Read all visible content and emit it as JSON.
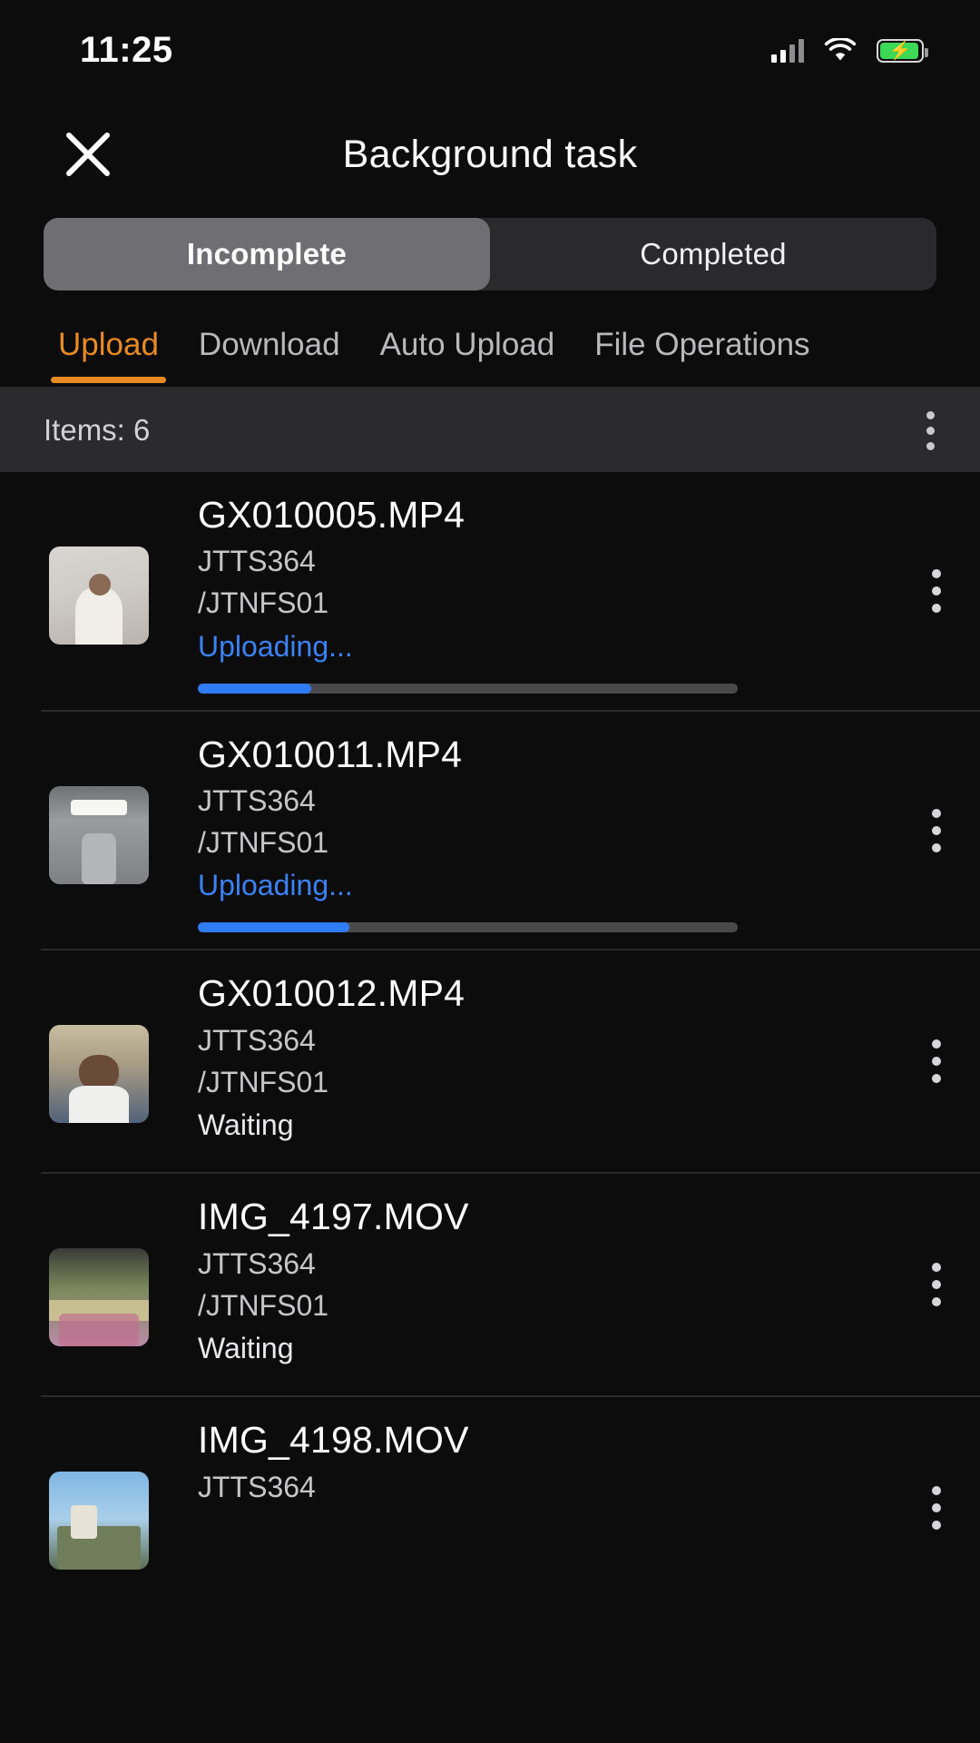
{
  "statusbar": {
    "time": "11:25",
    "icons": [
      "cellular-signal-icon",
      "wifi-icon",
      "battery-charging-icon"
    ]
  },
  "header": {
    "close_icon": "close-icon",
    "title": "Background task"
  },
  "segmented_control": {
    "selected": "Incomplete",
    "options": [
      {
        "label": "Incomplete",
        "active": true
      },
      {
        "label": "Completed",
        "active": false
      }
    ]
  },
  "tabs": {
    "active": "Upload",
    "accent_color": "#e98a23",
    "items": [
      {
        "label": "Upload",
        "active": true
      },
      {
        "label": "Download",
        "active": false
      },
      {
        "label": "Auto Upload",
        "active": false
      },
      {
        "label": "File Operations",
        "active": false
      }
    ]
  },
  "items_bar": {
    "label": "Items: 6",
    "count": 6,
    "menu_icon": "more-vertical-icon"
  },
  "task_list": [
    {
      "name": "GX010005.MP4",
      "device": "JTTS364",
      "path": "/JTNFS01",
      "status": "Uploading...",
      "status_type": "uploading",
      "progress": 21,
      "thumbnail": "video-thumbnail-person-white-shirt",
      "menu_icon": "more-vertical-icon"
    },
    {
      "name": "GX010011.MP4",
      "device": "JTTS364",
      "path": "/JTNFS01",
      "status": "Uploading...",
      "status_type": "uploading",
      "progress": 28,
      "thumbnail": "video-thumbnail-interior-ceiling-light",
      "menu_icon": "more-vertical-icon"
    },
    {
      "name": "GX010012.MP4",
      "device": "JTTS364",
      "path": "/JTNFS01",
      "status": "Waiting",
      "status_type": "waiting",
      "progress": null,
      "thumbnail": "video-thumbnail-person-backpack",
      "menu_icon": "more-vertical-icon"
    },
    {
      "name": "IMG_4197.MOV",
      "device": "JTTS364",
      "path": "/JTNFS01",
      "status": "Waiting",
      "status_type": "waiting",
      "progress": null,
      "thumbnail": "video-thumbnail-crowd-outdoor",
      "menu_icon": "more-vertical-icon"
    },
    {
      "name": "IMG_4198.MOV",
      "device": "JTTS364",
      "path": "",
      "status": "",
      "status_type": "waiting",
      "progress": null,
      "thumbnail": "video-thumbnail-sky-field",
      "menu_icon": "more-vertical-icon"
    }
  ],
  "colors": {
    "background": "#0c0c0c",
    "accent_orange": "#e98a23",
    "progress_blue": "#2f7cf6",
    "status_blue": "#3b82f6",
    "segment_active": "#6e6e73",
    "bar_background": "#2b2b2d",
    "battery_green": "#3cd856"
  }
}
